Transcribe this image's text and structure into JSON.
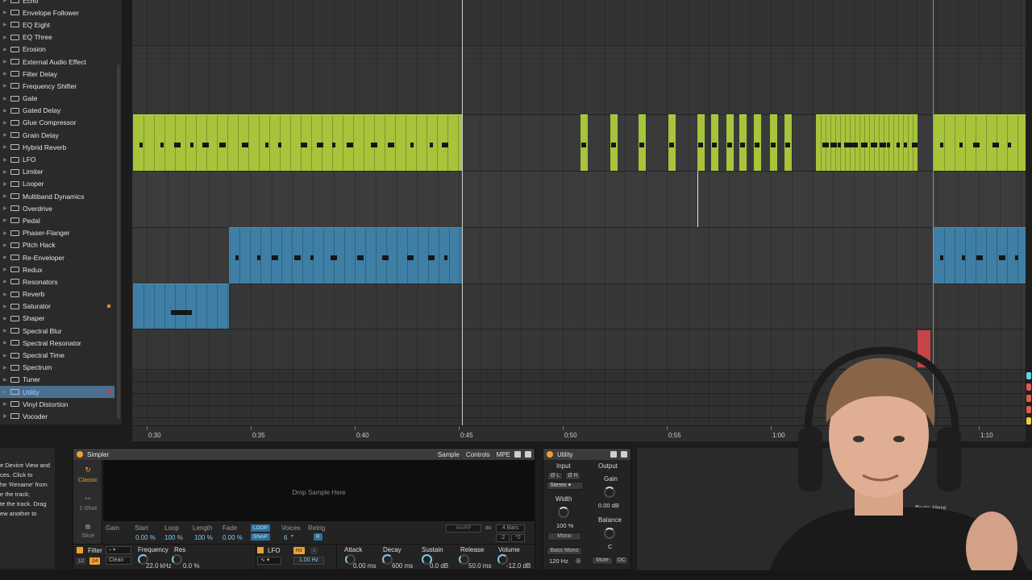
{
  "browser": {
    "items": [
      {
        "label": "Echo"
      },
      {
        "label": "Envelope Follower"
      },
      {
        "label": "EQ Eight"
      },
      {
        "label": "EQ Three"
      },
      {
        "label": "Erosion"
      },
      {
        "label": "External Audio Effect"
      },
      {
        "label": "Filter Delay"
      },
      {
        "label": "Frequency Shifter"
      },
      {
        "label": "Gate"
      },
      {
        "label": "Gated Delay"
      },
      {
        "label": "Glue Compressor"
      },
      {
        "label": "Grain Delay"
      },
      {
        "label": "Hybrid Reverb"
      },
      {
        "label": "LFO"
      },
      {
        "label": "Limiter"
      },
      {
        "label": "Looper"
      },
      {
        "label": "Multiband Dynamics"
      },
      {
        "label": "Overdrive"
      },
      {
        "label": "Pedal"
      },
      {
        "label": "Phaser-Flanger"
      },
      {
        "label": "Pitch Hack"
      },
      {
        "label": "Re-Enveloper"
      },
      {
        "label": "Redux"
      },
      {
        "label": "Resonators"
      },
      {
        "label": "Reverb"
      },
      {
        "label": "Saturator",
        "mark": "#e08a1a"
      },
      {
        "label": "Shaper"
      },
      {
        "label": "Spectral Blur"
      },
      {
        "label": "Spectral Resonator"
      },
      {
        "label": "Spectral Time"
      },
      {
        "label": "Spectrum"
      },
      {
        "label": "Tuner"
      },
      {
        "label": "Utility",
        "selected": true,
        "mark": "#d23a3a"
      },
      {
        "label": "Vinyl Distortion"
      },
      {
        "label": "Vocoder"
      }
    ]
  },
  "timeline": {
    "ticks": [
      "0:30",
      "0:35",
      "0:40",
      "0:45",
      "0:50",
      "0:55",
      "1:00",
      "1:10"
    ]
  },
  "colors": {
    "clip_green": "#a7c43b",
    "clip_blue": "#3f7fa6",
    "clip_red": "#c74448",
    "accent_orange": "#f0a030",
    "value_blue": "#7fc8f0"
  },
  "info_view": {
    "lines": [
      "e Device View and",
      "ces. Click to",
      "he 'Rename' from",
      "e the track;",
      "te the track. Drag",
      "ew another to"
    ]
  },
  "simpler": {
    "title": "Simpler",
    "tabs": [
      "Sample",
      "Controls",
      "MPE"
    ],
    "modes": [
      "Classic",
      "1-Shot",
      "Slice"
    ],
    "drop_text": "Drop Sample Here",
    "warp": "WARP",
    "as": "as",
    "bars": "4 Bars",
    "half": ":2",
    "double": "*2",
    "params": {
      "gain": "Gain",
      "start": "Start",
      "start_val": "0.00 %",
      "loop": "Loop",
      "loop_val": "100 %",
      "length": "Length",
      "length_val": "100 %",
      "fade": "Fade",
      "fade_val": "0.00 %",
      "loop_btn": "LOOP",
      "snap_btn": "SNAP",
      "voices": "Voices",
      "voices_val": "6",
      "retrig": "Retrig",
      "retrig_val": "R"
    },
    "filter": {
      "label": "Filter",
      "slope_12": "12",
      "slope_24": "24",
      "type": "Clean",
      "frequency": "Frequency",
      "frequency_val": "22.0 kHz",
      "res": "Res",
      "res_val": "0.0 %"
    },
    "lfo": {
      "label": "LFO",
      "hz": "Hz",
      "rate_val": "1.00 Hz"
    },
    "env": {
      "attack": "Attack",
      "attack_val": "0.00 ms",
      "decay": "Decay",
      "decay_val": "600 ms",
      "sustain": "Sustain",
      "sustain_val": "0.0 dB",
      "release": "Release",
      "release_val": "50.0 ms",
      "volume": "Volume",
      "volume_val": "-12.0 dB"
    }
  },
  "utility": {
    "title": "Utility",
    "input": "Input",
    "output": "Output",
    "phase_l": "Ø L",
    "phase_r": "Ø R",
    "channel_mode": "Stereo",
    "gain": "Gain",
    "gain_val": "0.00 dB",
    "width": "Width",
    "width_val": "100 %",
    "mono": "Mono",
    "balance": "Balance",
    "balance_val": "C",
    "bass_mono": "Bass Mono",
    "bass_freq": "120 Hz",
    "mute": "Mute",
    "dc": "DC"
  },
  "empty_panel_hint": "ffects Here"
}
